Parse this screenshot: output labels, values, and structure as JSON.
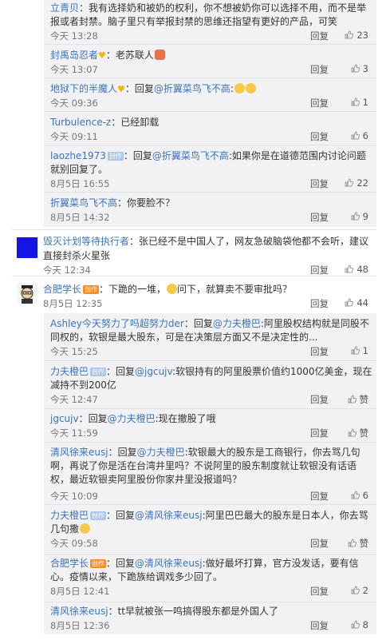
{
  "thread1": [
    {
      "user": "立青贝",
      "text": "：我有选择奶和被奶的权利，你不想被奶你可以选择不用，而不是举",
      "text2": "报或者封禁。脑子里只有举报封禁的思维还指望有更好的产品，可笑",
      "time": "今天 13:28",
      "reply": "回复",
      "likes": "23"
    },
    {
      "user": "封禹岛忍者",
      "text": "：老苏联人",
      "time": "今天 13:07",
      "reply": "回复",
      "likes": "3"
    },
    {
      "user": "地狱下的半魔人",
      "text": "：回复",
      "mention": "@折翼菜鸟飞不高",
      "text_after": ":",
      "time": "今天 09:36",
      "reply": "回复",
      "likes": "1"
    },
    {
      "user": "Turbulence-z",
      "text": "：已经卸载",
      "time": "今天 09:11",
      "reply": "回复",
      "likes": "6"
    },
    {
      "user": "laozhe1973",
      "badge": "创作",
      "text": "：回复",
      "mention": "@折翼菜鸟飞不高",
      "text_after": ":如果你是在道德范围内讨论问题",
      "text2": "就别回复了。",
      "time": "8月5日 16:55",
      "reply": "回复",
      "likes": "22"
    },
    {
      "user": "折翼菜鸟飞不高",
      "text": "：你要脸不？",
      "time": "8月5日 14:32",
      "reply": "回复",
      "likes": "9"
    }
  ],
  "top2": {
    "user": "毁灭计划等待执行者",
    "text": "：张已经不是中国人了，网友急破脑袋他都不会听，建议",
    "text2": "直接封杀火星张",
    "time": "今天 12:34",
    "reply": "回复",
    "likes": "48"
  },
  "top3": {
    "user": "合肥学长",
    "badge": "创作",
    "text": "：下跪的一堆，",
    "text_b": "问下，就算卖不要审批吗？",
    "time": "8月5日 12:35",
    "reply": "回复",
    "likes": "44"
  },
  "thread3": [
    {
      "user": "Ashley今天努力了吗超努力der",
      "text": "：回复",
      "mention": "@力夫橙巴",
      "text_after": ":阿里股权结构就是同股不",
      "text2": "同权的，软银是最大股东，可是在决策层方面又不是决定性的...",
      "time": "今天 15:25",
      "reply": "回复",
      "likes": "1"
    },
    {
      "user": "力夫橙巴",
      "badge": "创作",
      "text": "：回复",
      "mention": "@jgcujv",
      "text_after": ":软银持有的阿里股票价值约1000亿美金，现在",
      "text2": "减持不到200亿",
      "time": "今天 12:47",
      "reply": "回复",
      "likes": "赞"
    },
    {
      "user": "jgcujv",
      "text": "：回复",
      "mention": "@力夫橙巴",
      "text_after": ":现在撤股了哦",
      "time": "今天 11:59",
      "reply": "回复",
      "likes": "赞"
    },
    {
      "user": "清风徐来eusj",
      "text": "：回复",
      "mention": "@力夫橙巴",
      "text_after": ":软银最大的股东是工商银行，你去骂几句",
      "text2": "啊，再说了你是活在台湾井里吗？不说阿里的股东制度就让软银没有话语",
      "text3": "权，最近软银卖阿里股份你家井里没报道吗？",
      "time": "今天 10:09",
      "reply": "回复",
      "likes": "6"
    },
    {
      "user": "力夫橙巴",
      "badge": "创作",
      "text": "：回复",
      "mention": "@清风徐来eusj",
      "text_after": ":阿里巴巴最大的股东是日本人，你去骂",
      "text2": "几句撒",
      "time": "今天 09:58",
      "reply": "回复",
      "likes": "赞"
    },
    {
      "user": "合肥学长",
      "badge": "创作",
      "text": "：回复",
      "mention": "@清风徐来eusj",
      "text_after": ":做好最坏打算，官方没发话，要有信",
      "text2": "心。疫情以来，下跪族给调戏多少回了。",
      "time": "8月5日 12:41",
      "reply": "回复",
      "likes": "2"
    },
    {
      "user": "清风徐来eusj",
      "text": "：tt早就被张一鸣搞得股东都是外国人了",
      "time": "8月5日 12:36",
      "reply": "回复",
      "likes": "8"
    }
  ],
  "colors": {
    "link": "#3b73b9",
    "panel": "#f2f2f5",
    "text": "#333333",
    "meta": "#777777"
  }
}
